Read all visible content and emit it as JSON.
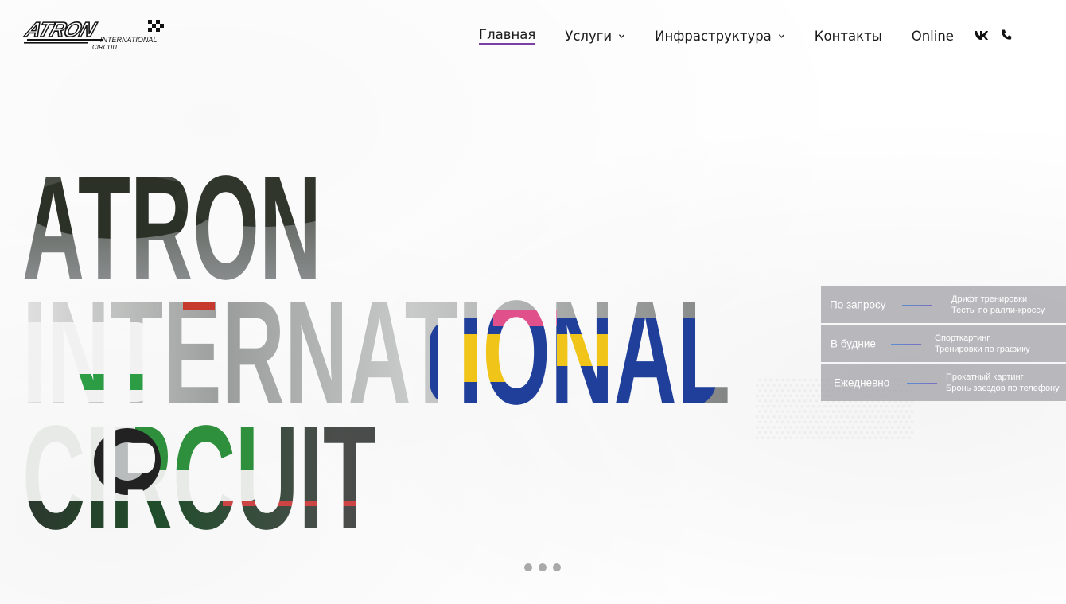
{
  "brand": {
    "logo_main": "ATRON",
    "logo_sub1": "INTERNATIONAL",
    "logo_sub2": "CIRCUIT"
  },
  "nav": {
    "items": [
      {
        "label": "Главная",
        "active": true,
        "dropdown": false
      },
      {
        "label": "Услуги",
        "active": false,
        "dropdown": true
      },
      {
        "label": "Инфраструктура",
        "active": false,
        "dropdown": true
      },
      {
        "label": "Контакты",
        "active": false,
        "dropdown": false
      },
      {
        "label": "Online",
        "active": false,
        "dropdown": false
      }
    ],
    "social": [
      "vk-icon",
      "phone-icon"
    ]
  },
  "hero": {
    "line1": "ATRON",
    "line2": "INTERNATIONAL",
    "line3": "CIRCUIT"
  },
  "schedule": [
    {
      "label": "По запросу",
      "desc1": "Дрифт тренировки",
      "desc2": "Тесты по ралли-кроссу"
    },
    {
      "label": "В будние",
      "desc1": "Спорткартинг",
      "desc2": "Тренировки по графику"
    },
    {
      "label": "Ежедневно",
      "desc1": "Прокатный картинг",
      "desc2": "Бронь заездов по телефону"
    }
  ],
  "slider": {
    "dots": 3
  },
  "colors": {
    "accent": "#7b3fa6",
    "panel": "#a0a0a5",
    "text": "#1a1a1a"
  }
}
